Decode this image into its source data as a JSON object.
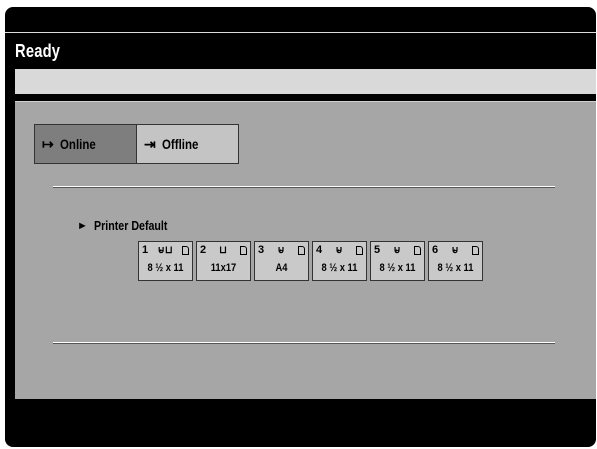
{
  "header": {
    "title": "Ready"
  },
  "mode": {
    "online_label": "Online",
    "offline_label": "Offline",
    "online_icon": "arrow-to-bar-icon",
    "offline_icon": "bar-arrow-icon"
  },
  "paper": {
    "selection_label": "Printer Default",
    "trays": [
      {
        "number": "1",
        "size": "8 ½ x 11",
        "icon": "bypass-tray-icon"
      },
      {
        "number": "2",
        "size": "11x17",
        "icon": "tray-icon"
      },
      {
        "number": "3",
        "size": "A4",
        "icon": "tray-icon"
      },
      {
        "number": "4",
        "size": "8 ½ x 11",
        "icon": "tray-icon"
      },
      {
        "number": "5",
        "size": "8 ½ x 11",
        "icon": "tray-icon"
      },
      {
        "number": "6",
        "size": "8 ½ x 11",
        "icon": "tray-icon"
      }
    ]
  }
}
